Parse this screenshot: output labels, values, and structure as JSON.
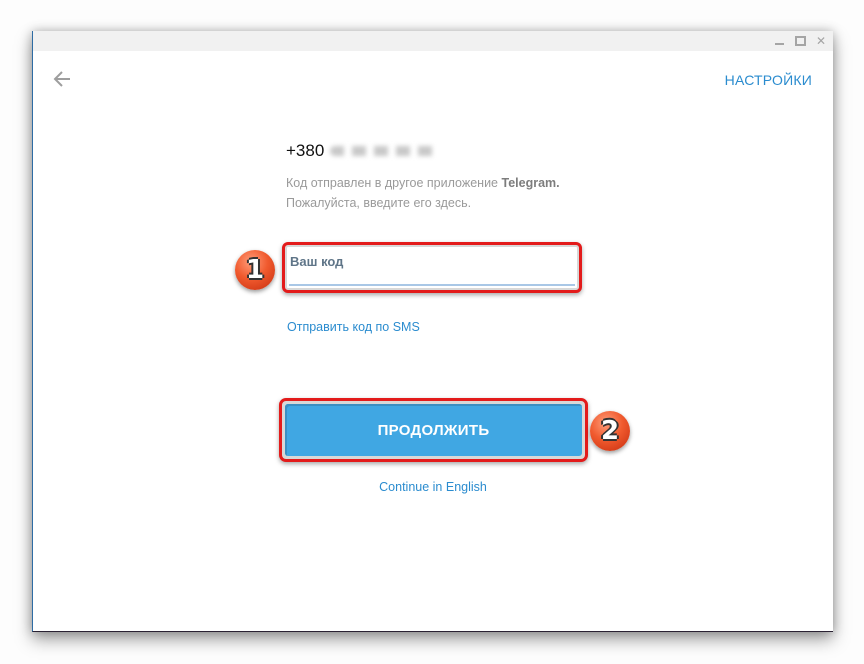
{
  "window": {
    "controls": {
      "minimize": "minimize",
      "maximize": "maximize",
      "close": "close"
    }
  },
  "header": {
    "back_icon": "arrow-left-icon",
    "settings_label": "НАСТРОЙКИ"
  },
  "main": {
    "phone_prefix": "+380",
    "hint_text": "Код отправлен в другое приложение ",
    "hint_app": "Telegram.",
    "hint_line2": "Пожалуйста, введите его здесь.",
    "code_input": {
      "value": "",
      "placeholder": "Ваш код"
    },
    "sms_link": "Отправить код по SMS",
    "continue_button": "ПРОДОЛЖИТЬ",
    "english_link": "Continue in English"
  },
  "annotations": {
    "step1": "1",
    "step2": "2",
    "highlight_color": "#e31b1b"
  },
  "colors": {
    "accent": "#2b8ccf",
    "button": "#40a7e3"
  }
}
